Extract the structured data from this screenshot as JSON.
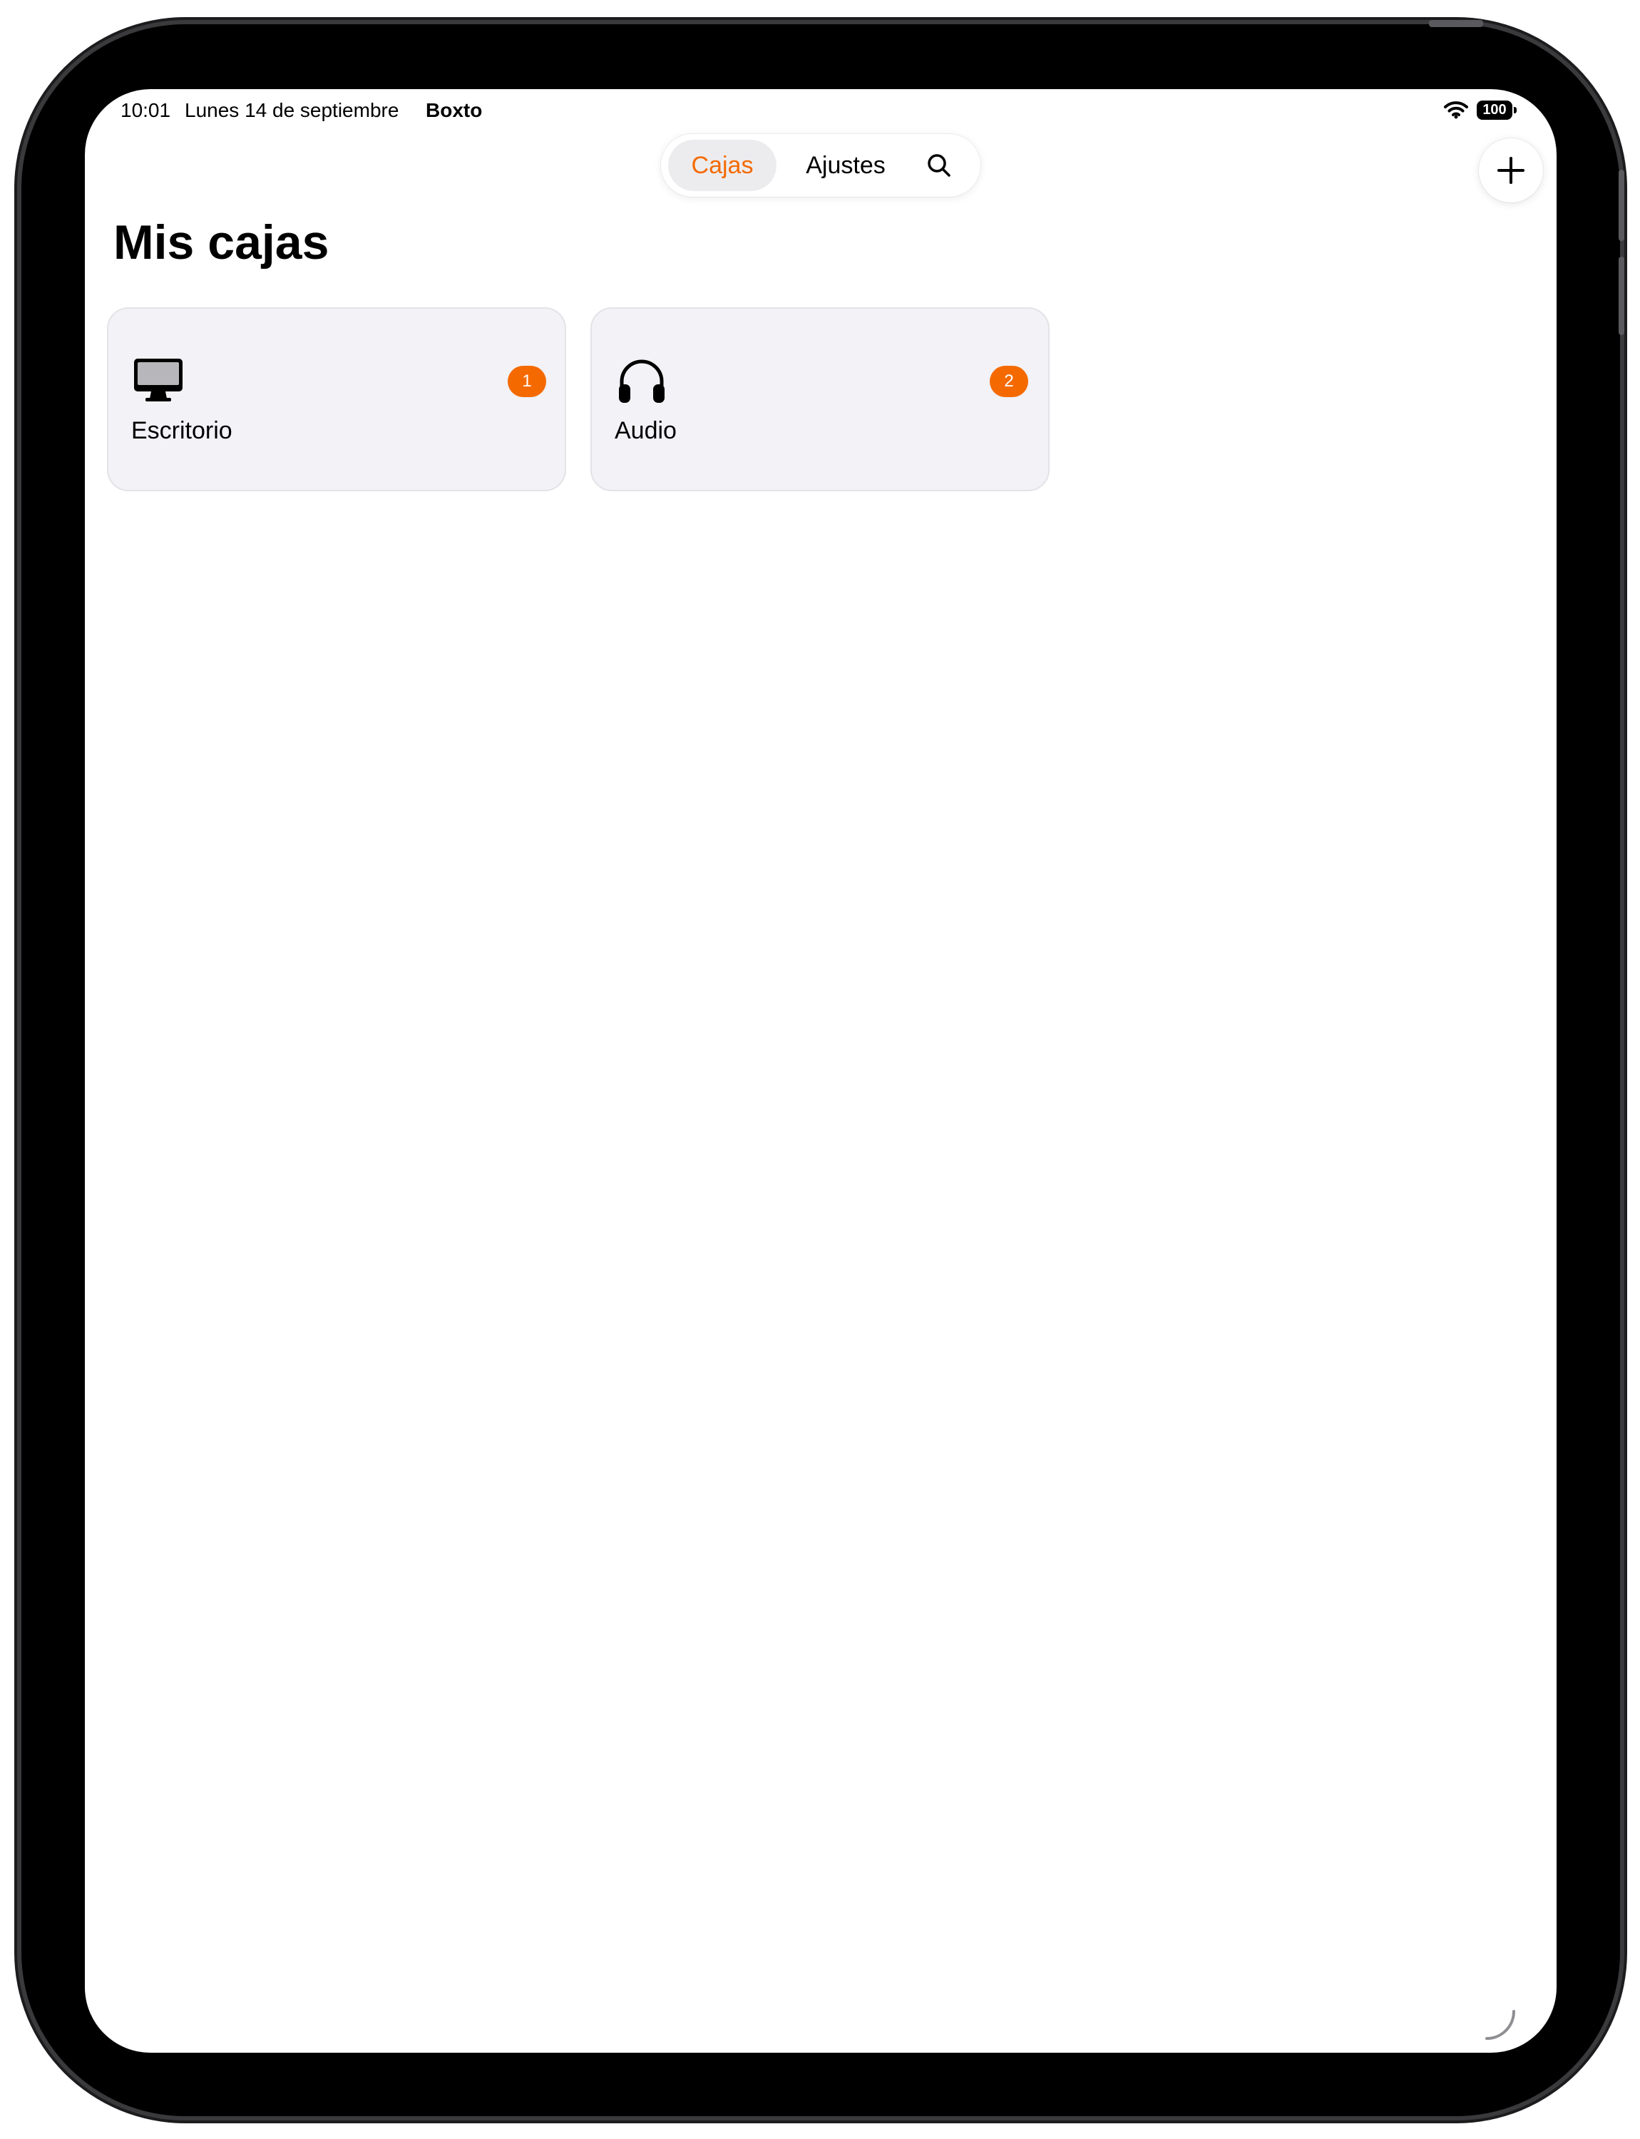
{
  "status_bar": {
    "time": "10:01",
    "date": "Lunes 14 de septiembre",
    "app": "Boxto",
    "battery": "100"
  },
  "nav": {
    "tabs": [
      {
        "label": "Cajas",
        "selected": true
      },
      {
        "label": "Ajustes",
        "selected": false
      }
    ],
    "search_icon": "search-icon",
    "add_icon": "plus-icon"
  },
  "page": {
    "title": "Mis cajas"
  },
  "boxes": [
    {
      "label": "Escritorio",
      "icon": "desktop-icon",
      "count": "1"
    },
    {
      "label": "Audio",
      "icon": "headphones-icon",
      "count": "2"
    }
  ],
  "colors": {
    "accent": "#f56a00",
    "card_background": "#f2f2f7",
    "selected_tab": "#ececee"
  }
}
